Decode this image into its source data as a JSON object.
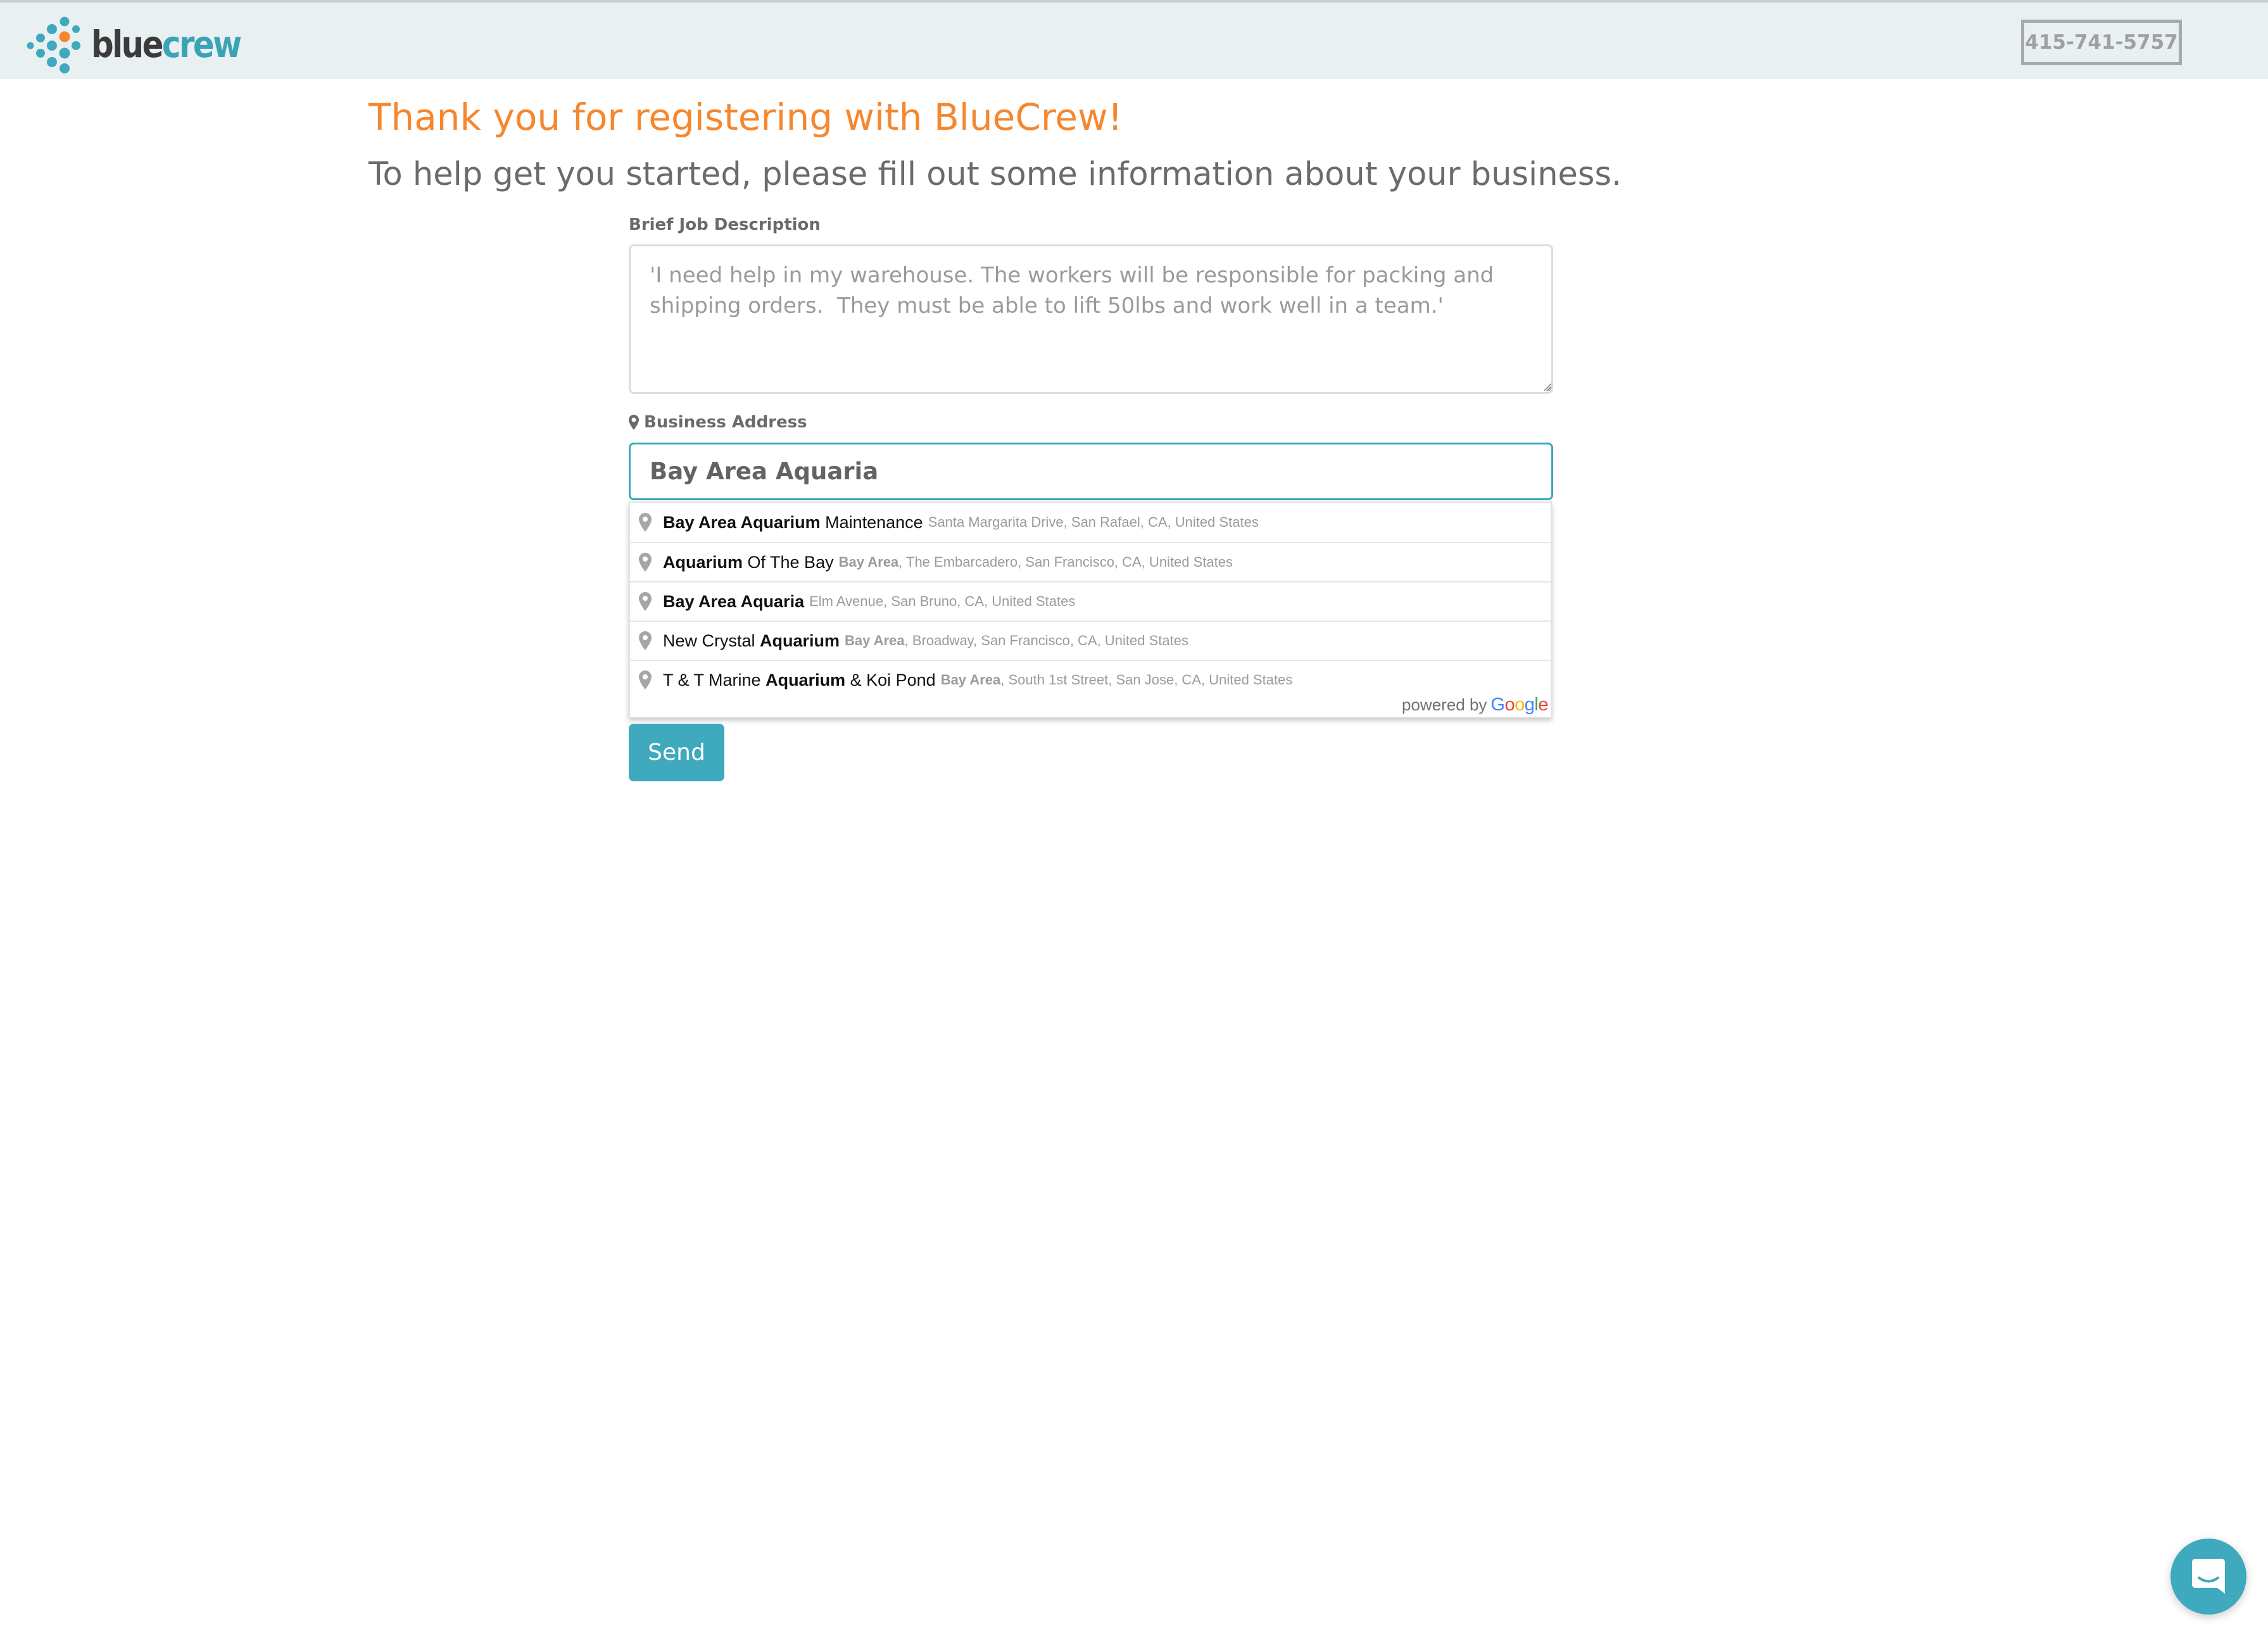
{
  "header": {
    "logo": {
      "icon": "bluecrew-dots-logo-icon",
      "word_blue": "blue",
      "word_crew": "crew"
    },
    "phone": "415-741-5757"
  },
  "main": {
    "title": "Thank you for registering with BlueCrew!",
    "subtitle": "To help get you started, please fill out some information about your business.",
    "job_description": {
      "label": "Brief Job Description",
      "placeholder": "'I need help in my warehouse. The workers will be responsible for packing and shipping orders.  They must be able to lift 50lbs and work well in a team.'",
      "value": ""
    },
    "business_address": {
      "label": "Business Address",
      "label_icon": "map-marker-icon",
      "value": "Bay Area Aquaria"
    },
    "suggestions": [
      {
        "main_parts": [
          {
            "text": "Bay Area Aquarium",
            "bold": true
          },
          {
            "text": " Maintenance",
            "bold": false
          }
        ],
        "secondary_parts": [
          {
            "text": "Santa Margarita Drive, San Rafael, CA, United States",
            "bold": false
          }
        ]
      },
      {
        "main_parts": [
          {
            "text": "Aquarium",
            "bold": true
          },
          {
            "text": " Of The Bay",
            "bold": false
          }
        ],
        "secondary_parts": [
          {
            "text": "Bay Area",
            "bold": true
          },
          {
            "text": ", The Embarcadero, San Francisco, CA, United States",
            "bold": false
          }
        ]
      },
      {
        "main_parts": [
          {
            "text": "Bay Area Aquaria",
            "bold": true
          }
        ],
        "secondary_parts": [
          {
            "text": "Elm Avenue, San Bruno, CA, United States",
            "bold": false
          }
        ]
      },
      {
        "main_parts": [
          {
            "text": "New Crystal ",
            "bold": false
          },
          {
            "text": "Aquarium",
            "bold": true
          }
        ],
        "secondary_parts": [
          {
            "text": "Bay Area",
            "bold": true
          },
          {
            "text": ", Broadway, San Francisco, CA, United States",
            "bold": false
          }
        ]
      },
      {
        "main_parts": [
          {
            "text": "T & T Marine ",
            "bold": false
          },
          {
            "text": "Aquarium",
            "bold": true
          },
          {
            "text": " & Koi Pond",
            "bold": false
          }
        ],
        "secondary_parts": [
          {
            "text": "Bay Area",
            "bold": true
          },
          {
            "text": ", South 1st Street, San Jose, CA, United States",
            "bold": false
          }
        ]
      }
    ],
    "powered_by": {
      "text": "powered by",
      "brand": "Google",
      "brand_colors": [
        "#4285F4",
        "#EA4335",
        "#FBBC05",
        "#4285F4",
        "#34A853",
        "#EA4335"
      ]
    },
    "send_label": "Send"
  },
  "chat": {
    "icon": "chat-bubble-icon"
  },
  "colors": {
    "accent": "#3fa9bd",
    "title_orange": "#f5872f",
    "header_bg": "#e8f0f2"
  }
}
